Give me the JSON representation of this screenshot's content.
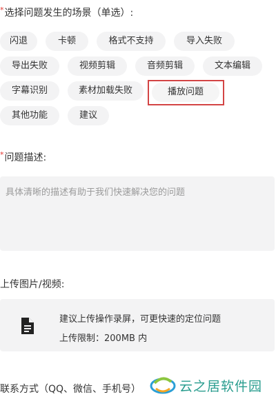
{
  "scene": {
    "required_mark": "*",
    "label": "选择问题发生的场景（单选）:",
    "options": [
      "闪退",
      "卡顿",
      "格式不支持",
      "导入失败",
      "导出失败",
      "视频剪辑",
      "音频剪辑",
      "文本编辑",
      "字幕识别",
      "素材加载失败",
      "播放问题",
      "其他功能",
      "建议"
    ],
    "selected": "播放问题"
  },
  "description": {
    "required_mark": "*",
    "label": "问题描述:",
    "placeholder": "具体清晰的描述有助于我们快速解决您的问题"
  },
  "upload": {
    "label": "上传图片/视频:",
    "icon": "document-icon",
    "hint": "建议上传操作录屏，可更快速的定位问题",
    "limit": "上传限制：200MB 内"
  },
  "contact": {
    "label": "联系方式（QQ、微信、手机号）"
  },
  "watermark": {
    "text": "云之居软件园"
  },
  "colors": {
    "required": "#e3352f",
    "chip_bg": "#f3f3f4",
    "highlight": "#d34444",
    "watermark": "#2a9d8f"
  }
}
